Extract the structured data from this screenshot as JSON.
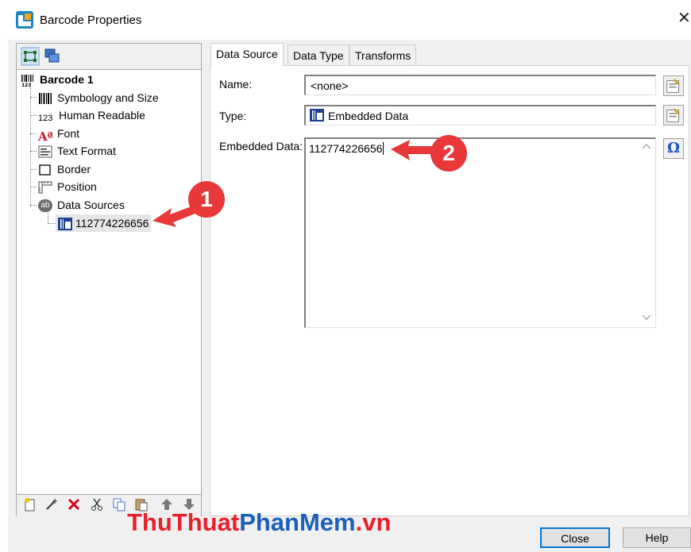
{
  "window": {
    "title": "Barcode Properties",
    "close_glyph": "✕"
  },
  "tree": {
    "root": "Barcode 1",
    "items": [
      {
        "label": "Symbology and Size",
        "icon": "barcode-bars-icon"
      },
      {
        "label": "Human Readable",
        "icon": "digits-123-icon"
      },
      {
        "label": "Font",
        "icon": "font-a-icon"
      },
      {
        "label": "Text Format",
        "icon": "text-format-icon"
      },
      {
        "label": "Border",
        "icon": "border-square-icon"
      },
      {
        "label": "Position",
        "icon": "position-ruler-icon"
      },
      {
        "label": "Data Sources",
        "icon": "data-sources-icon"
      }
    ],
    "child": "112774226656",
    "digits_icon_text": "123",
    "font_icon_text": "Aª",
    "ds_icon_text": "ab"
  },
  "tabs": [
    "Data Source",
    "Data Type",
    "Transforms"
  ],
  "form": {
    "name_label": "Name:",
    "name_value": "<none>",
    "type_label": "Type:",
    "type_value": "Embedded Data",
    "embedded_label": "Embedded Data:",
    "embedded_value": "112774226656",
    "omega": "Ω"
  },
  "buttons": {
    "close": "Close",
    "help": "Help"
  },
  "watermark": {
    "part1": "ThuThuat",
    "part2": "PhanMem",
    "part3": ".vn"
  },
  "annotations": {
    "badge1": "1",
    "badge2": "2"
  },
  "colors": {
    "accent": "#0078d7",
    "annotation_red": "#e8383a",
    "watermark_red": "#e8202a",
    "watermark_blue": "#1c5fb8"
  }
}
